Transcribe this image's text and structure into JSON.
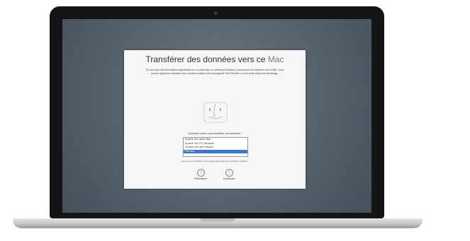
{
  "dialog": {
    "title_main": "Transférer des données vers ce ",
    "title_mac": "Mac",
    "description": "Si vous avez des informations importantes sur un autre Mac ou ordinateur Windows, vous pouvez les transférer sur ce Mac. Vous pouvez également transférer des données à partir d'une sauvegarde Time Machine ou d'un autre disque de démarrage.",
    "question": "Comment voulez-vous transférer vos données ?",
    "options": [
      "À partir d'un autre Mac",
      "À partir d'un PC Windows",
      "À partir d'un autre disque",
      "Pas tout"
    ],
    "selected_index": 3,
    "note": "Vous pourrez transférer les données plus tard avec Assistant migration.",
    "back_label": "Précédent",
    "continue_label": "Continuer"
  },
  "colors": {
    "selection": "#3875d7",
    "desktop": "#4e5b68"
  },
  "icons": {
    "finder": "finder-icon",
    "back": "chevron-left-icon",
    "continue": "chevron-right-icon"
  }
}
